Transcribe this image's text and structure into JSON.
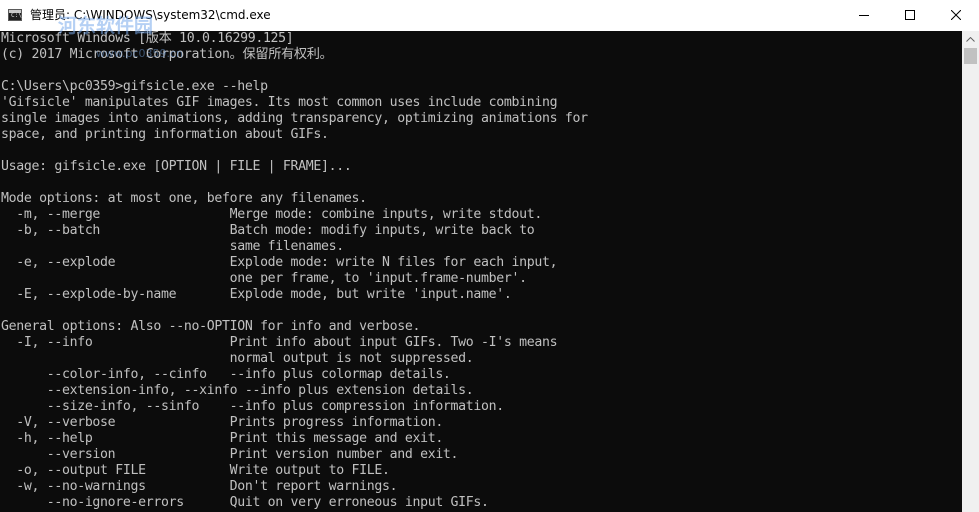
{
  "window": {
    "title": "管理员: C:\\WINDOWS\\system32\\cmd.exe",
    "icon": "cmd-icon",
    "icon_glyph": "C:\\",
    "controls": {
      "minimize": "minimize-icon",
      "maximize": "maximize-icon",
      "close": "close-icon"
    }
  },
  "watermark": {
    "text": "河东软件园",
    "sub": "www.pc0359.cn"
  },
  "console": {
    "foreground": "#c0c0c0",
    "background": "#0c0c0c",
    "lines": [
      "Microsoft Windows [版本 10.0.16299.125]",
      "(c) 2017 Microsoft Corporation。保留所有权利。",
      "",
      "C:\\Users\\pc0359>gifsicle.exe --help",
      "'Gifsicle' manipulates GIF images. Its most common uses include combining",
      "single images into animations, adding transparency, optimizing animations for",
      "space, and printing information about GIFs.",
      "",
      "Usage: gifsicle.exe [OPTION | FILE | FRAME]...",
      "",
      "Mode options: at most one, before any filenames.",
      "  -m, --merge                 Merge mode: combine inputs, write stdout.",
      "  -b, --batch                 Batch mode: modify inputs, write back to",
      "                              same filenames.",
      "  -e, --explode               Explode mode: write N files for each input,",
      "                              one per frame, to 'input.frame-number'.",
      "  -E, --explode-by-name       Explode mode, but write 'input.name'.",
      "",
      "General options: Also --no-OPTION for info and verbose.",
      "  -I, --info                  Print info about input GIFs. Two -I's means",
      "                              normal output is not suppressed.",
      "      --color-info, --cinfo   --info plus colormap details.",
      "      --extension-info, --xinfo --info plus extension details.",
      "      --size-info, --sinfo    --info plus compression information.",
      "  -V, --verbose               Prints progress information.",
      "  -h, --help                  Print this message and exit.",
      "      --version               Print version number and exit.",
      "  -o, --output FILE           Write output to FILE.",
      "  -w, --no-warnings           Don't report warnings.",
      "      --no-ignore-errors      Quit on very erroneous input GIFs."
    ]
  },
  "scrollbar": {
    "up_arrow": "scroll-up-arrow-icon"
  }
}
